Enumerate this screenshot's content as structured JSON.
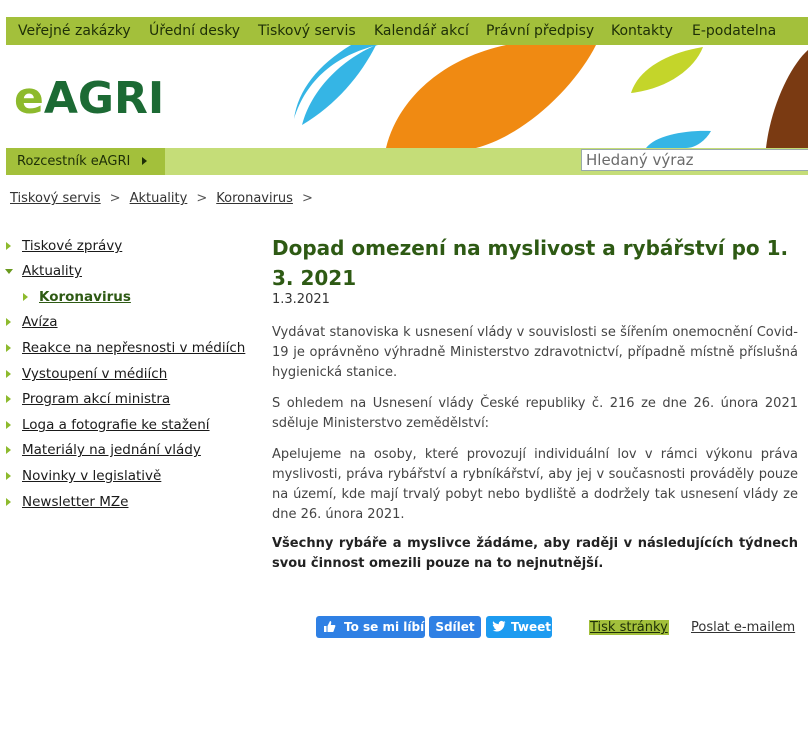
{
  "topnav": {
    "items": [
      "Veřejné zakázky",
      "Úřední desky",
      "Tiskový servis",
      "Kalendář akcí",
      "Právní předpisy",
      "Kontakty",
      "E-podatelna"
    ]
  },
  "header": {
    "logo_e": "e",
    "logo_agri": "AGRI"
  },
  "rozcestnik": {
    "label": "Rozcestník eAGRI"
  },
  "search": {
    "placeholder": "Hledaný výraz",
    "value": ""
  },
  "breadcrumb": {
    "items": [
      "Tiskový servis",
      "Aktuality",
      "Koronavirus"
    ],
    "separator": ">"
  },
  "sidebar": {
    "items": [
      {
        "label": "Tiskové zprávy"
      },
      {
        "label": "Aktuality"
      },
      {
        "label": "Koronavirus"
      },
      {
        "label": "Avíza"
      },
      {
        "label": "Reakce na nepřesnosti v médiích"
      },
      {
        "label": "Vystoupení v médiích"
      },
      {
        "label": "Program akcí ministra"
      },
      {
        "label": "Loga a fotografie ke stažení"
      },
      {
        "label": "Materiály na jednání vlády"
      },
      {
        "label": "Novinky v legislativě"
      },
      {
        "label": "Newsletter MZe"
      }
    ]
  },
  "article": {
    "title": "Dopad omezení na myslivost a rybářství po 1. 3. 2021",
    "date": "1.3.2021",
    "paragraphs": [
      "Vydávat stanoviska k usnesení vlády v souvislosti se šířením onemocnění Covid-19 je oprávněno výhradně Ministerstvo zdravotnictví, případně místně příslušná hygienická stanice.",
      "S ohledem na Usnesení vlády České republiky č. 216 ze dne 26. února 2021 sděluje Ministerstvo zemědělství:",
      "Apelujeme na osoby, které provozují individuální lov v rámci výkonu práva myslivosti, práva rybářství a rybníkářství, aby jej v současnosti prováděly pouze na území, kde mají trvalý pobyt nebo bydliště a dodržely tak usnesení vlády ze dne 26. února 2021.",
      "Všechny rybáře a myslivce žádáme, aby raději v následujících týdnech svou činnost omezili pouze na to nejnutnější."
    ]
  },
  "social": {
    "like": "To se mi líbí",
    "share": "Sdílet",
    "tweet": "Tweet",
    "color": "#2f80e4"
  },
  "tools": {
    "print": "Tisk stránky",
    "email": "Poslat e-mailem"
  },
  "colors": {
    "nav_green": "#a3c03b",
    "light_green": "#c5dd78",
    "title_green": "#2e5a14",
    "logo_dark": "#1c6a34",
    "logo_light": "#8dba2d"
  }
}
